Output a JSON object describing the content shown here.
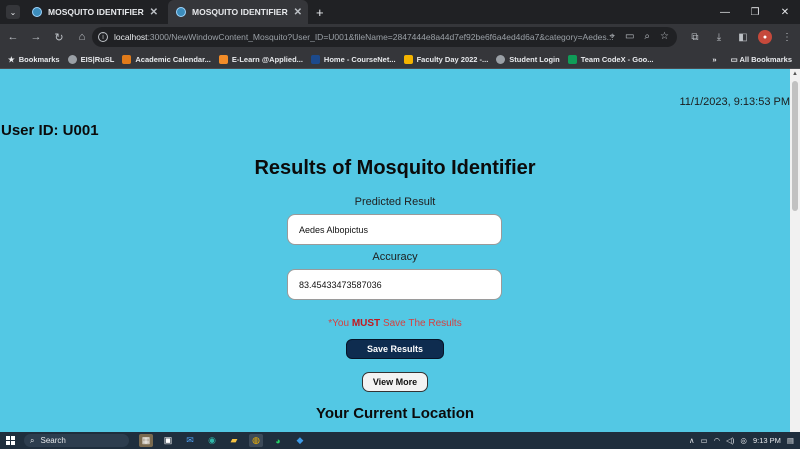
{
  "browser": {
    "tabs": [
      {
        "title": "MOSQUITO IDENTIFIER",
        "active": false
      },
      {
        "title": "MOSQUITO IDENTIFIER",
        "active": true
      }
    ],
    "url_host": "localhost",
    "url_rest": ":3000/NewWindowContent_Mosquito?User_ID=U001&fileName=2847444e8a44d7ef92be6f6a4ed4d6a7&category=Aedes...",
    "bookmarks": [
      "Bookmarks",
      "EIS|RuSL",
      "Academic Calendar...",
      "E-Learn @Applied...",
      "Home - CourseNet...",
      "Faculty Day 2022 -...",
      "Student Login",
      "Team CodeX - Goo..."
    ],
    "bookmark_overflow": "»",
    "all_bookmarks": "All Bookmarks"
  },
  "page": {
    "datetime": "11/1/2023, 9:13:53 PM",
    "user_id": "User ID: U001",
    "title": "Results of Mosquito Identifier",
    "predicted_label": "Predicted Result",
    "predicted_value": "Aedes Albopictus",
    "accuracy_label": "Accuracy",
    "accuracy_value": "83.45433473587036",
    "warning_prefix": "*You ",
    "warning_bold": "MUST",
    "warning_suffix": " Save The Results",
    "save_button": "Save Results",
    "view_more_button": "View More",
    "location_title": "Your Current Location"
  },
  "taskbar": {
    "search_label": "Search",
    "time": "9:13 PM"
  },
  "colors": {
    "page_bg": "#53c8e4",
    "save_button_bg": "#0e2c4f",
    "warning_text": "#d64040"
  }
}
